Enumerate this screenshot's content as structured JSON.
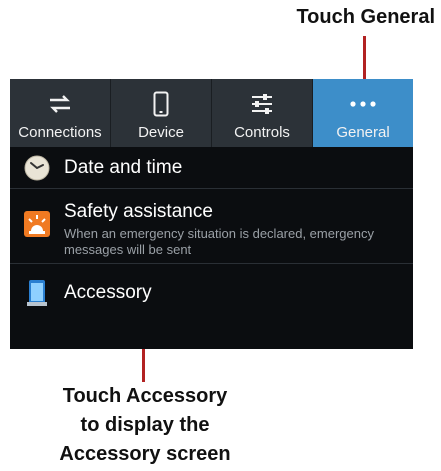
{
  "callouts": {
    "top": "Touch General",
    "bottom_lines": [
      "Touch Accessory",
      "to display the",
      "Accessory screen"
    ]
  },
  "tabs": [
    {
      "label": "Connections",
      "icon": "connections-icon",
      "selected": false
    },
    {
      "label": "Device",
      "icon": "device-icon",
      "selected": false
    },
    {
      "label": "Controls",
      "icon": "controls-icon",
      "selected": false
    },
    {
      "label": "General",
      "icon": "general-icon",
      "selected": true
    }
  ],
  "items": [
    {
      "title": "Date and time",
      "subtitle": "",
      "icon": "clock-icon"
    },
    {
      "title": "Safety assistance",
      "subtitle": "When an emergency situation is declared, emergency messages will be sent",
      "icon": "alarm-icon"
    },
    {
      "title": "Accessory",
      "subtitle": "",
      "icon": "accessory-icon"
    }
  ],
  "colors": {
    "accent": "#3d8ec9",
    "tab_bar": "#2c3238",
    "background": "#0b0d10",
    "leader": "#b22222"
  }
}
